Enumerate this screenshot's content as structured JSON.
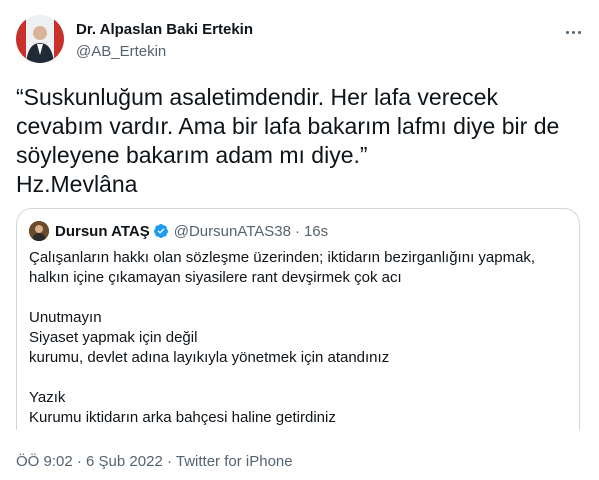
{
  "tweet": {
    "author": {
      "name": "Dr. Alpaslan Baki Ertekin",
      "handle": "@AB_Ertekin"
    },
    "text_lines": [
      "“Suskunluğum asaletimdendir. Her lafa verecek",
      "cevabım vardır. Ama bir lafa bakarım lafmı diye bir de",
      "söyleyene bakarım adam mı diye.”",
      "Hz.Mevlâna"
    ],
    "more_icon": "more-horizontal-icon"
  },
  "quote": {
    "name": "Dursun ATAŞ",
    "handle": "@DursunATAS38",
    "separator": "·",
    "time": "16s",
    "verified_icon": "verified-badge-icon",
    "body_lines": [
      "Çalışanların hakkı olan sözleşme üzerinden; iktidarın bezirganlığını yapmak,",
      "halkın içine çıkamayan siyasilere rant devşirmek çok acı",
      "",
      "Unutmayın",
      "Siyaset yapmak için değil",
      "kurumu, devlet adına layıkıyla yönetmek için atandınız",
      "",
      "Yazık",
      "Kurumu iktidarın arka bahçesi haline getirdiniz"
    ]
  },
  "meta": {
    "time": "ÖÖ 9:02",
    "date": "6 Şub 2022",
    "separator": "·",
    "source": "Twitter for iPhone"
  },
  "colors": {
    "text": "#0f1419",
    "secondary": "#536471",
    "border": "#cfd9de",
    "verified": "#1d9bf0"
  }
}
